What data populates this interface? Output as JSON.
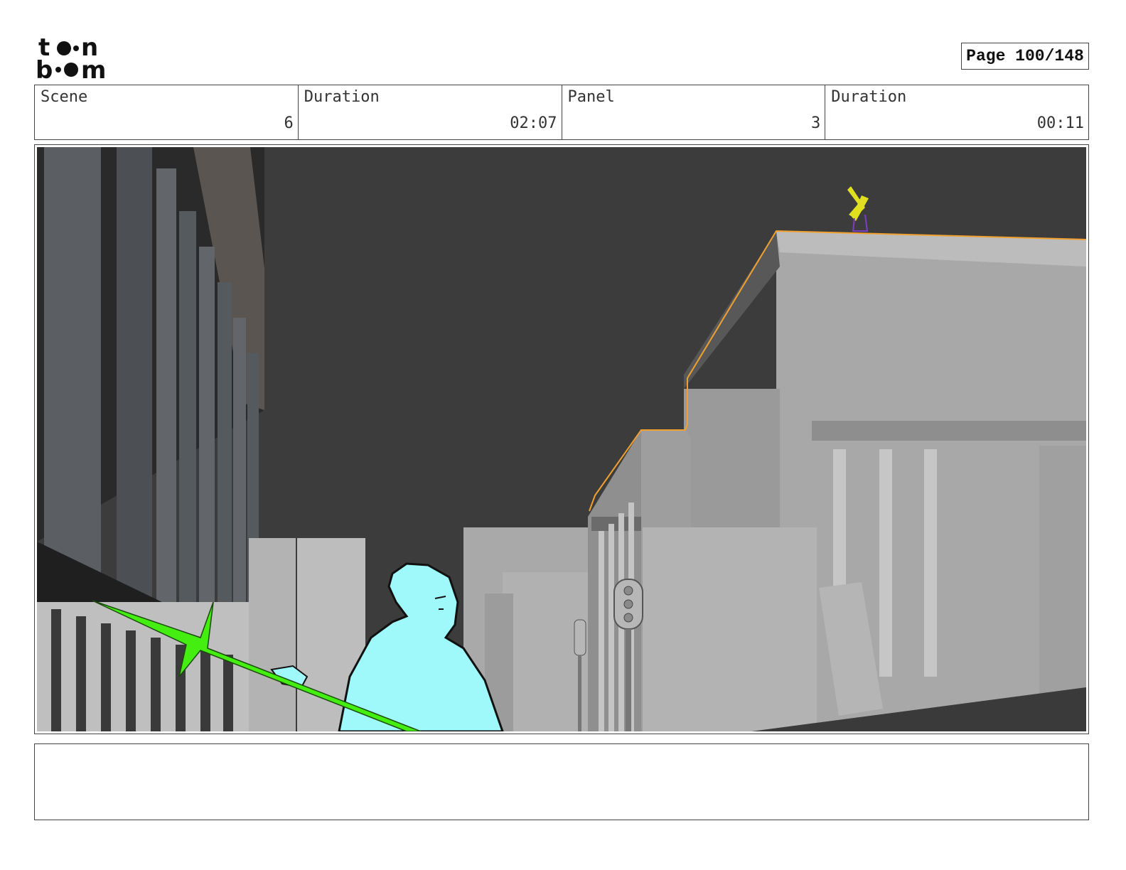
{
  "header": {
    "logo_text": "toon boom",
    "page_label": "Page 100/148"
  },
  "info_bar": {
    "scene_label": "Scene",
    "scene_value": "6",
    "scene_duration_label": "Duration",
    "scene_duration_value": "02:07",
    "panel_label": "Panel",
    "panel_value": "3",
    "panel_duration_label": "Duration",
    "panel_duration_value": "00:11"
  },
  "panel": {
    "description": "",
    "colors": {
      "sky": "#3c3c3c",
      "building": "#a6a6a6",
      "character": "#9ff9fb",
      "spear": "#44ee11",
      "outline": "#f0a030",
      "figure_yellow": "#e0e020"
    }
  }
}
